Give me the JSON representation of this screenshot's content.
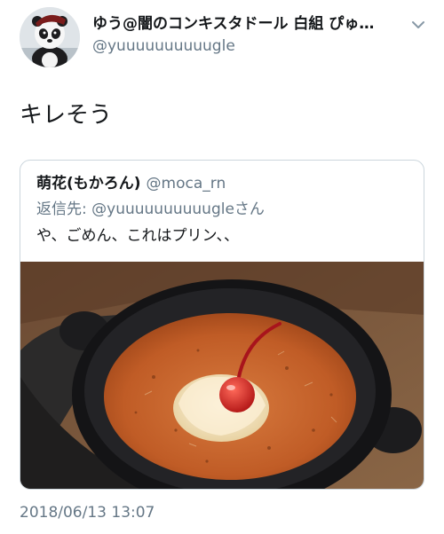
{
  "tweet": {
    "author": {
      "display_name": "ゆう@闇のコンキスタドール 白組 ぴゅ…",
      "handle": "@yuuuuuuuuuugle",
      "avatar_icon": "panda-avatar"
    },
    "menu_icon": "chevron-down-icon",
    "text": "キレそう",
    "timestamp": "2018/06/13 13:07"
  },
  "quote": {
    "display_name": "萌花(もかろん)",
    "handle": "@moca_rn",
    "reply_label": "返信先:",
    "reply_user": "@yuuuuuuuuuugle",
    "reply_suffix": "さん",
    "text": "や、ごめん、これはプリン、、",
    "media_icon": "food-photo"
  },
  "colors": {
    "text_primary": "#14171a",
    "text_secondary": "#657786",
    "border": "#ccd6dd",
    "background": "#ffffff"
  }
}
